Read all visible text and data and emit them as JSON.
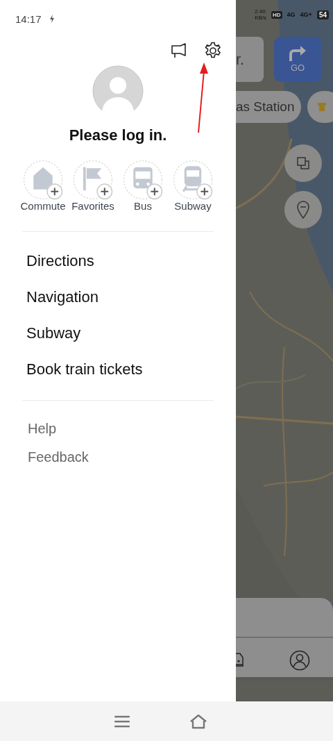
{
  "status_bar": {
    "time": "14:17",
    "speed": "2.40",
    "speed_unit": "KB/s",
    "hd": "HD",
    "network_1": "4G",
    "network_2": "4G+",
    "battery": "54"
  },
  "drawer": {
    "prompt": "Please log in.",
    "shortcuts": [
      {
        "label": "Commute",
        "kind": "home"
      },
      {
        "label": "Favorites",
        "kind": "flag"
      },
      {
        "label": "Bus",
        "kind": "bus"
      },
      {
        "label": "Subway",
        "kind": "train"
      }
    ],
    "menu": [
      "Directions",
      "Navigation",
      "Subway",
      "Book train tickets"
    ],
    "secondary": [
      "Help",
      "Feedback"
    ]
  },
  "map": {
    "kind": "picture",
    "search_text": "r.",
    "go_button": "GO",
    "chip": "as Station"
  }
}
